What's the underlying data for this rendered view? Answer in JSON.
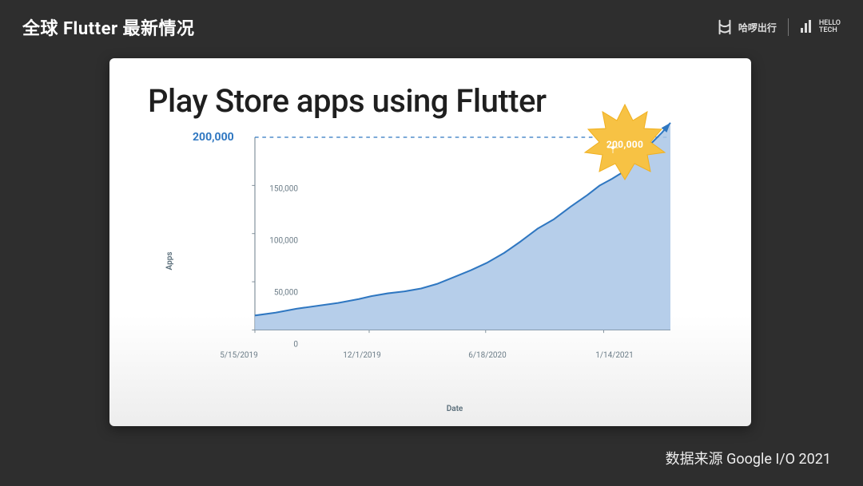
{
  "header": {
    "title": "全球 Flutter 最新情况",
    "logo1_text": "哈啰出行",
    "logo2_line1": "HELLO",
    "logo2_line2": "TECH"
  },
  "footer": {
    "source": "数据来源 Google I/O 2021"
  },
  "chart_data": {
    "type": "area",
    "title": "Play Store apps using Flutter",
    "xlabel": "Date",
    "ylabel": "Apps",
    "ylim": [
      0,
      200000
    ],
    "yticks": [
      0,
      50000,
      100000,
      150000
    ],
    "ytick_labels": [
      "0",
      "50,000",
      "100,000",
      "150,000"
    ],
    "xtick_labels": [
      "5/15/2019",
      "12/1/2019",
      "6/18/2020",
      "1/14/2021"
    ],
    "xtick_positions": [
      0.0,
      0.275,
      0.555,
      0.84
    ],
    "threshold": {
      "value": 200000,
      "label": "200,000"
    },
    "badge": {
      "text": "200,000"
    },
    "series": [
      {
        "name": "Apps",
        "x": [
          0.0,
          0.05,
          0.1,
          0.15,
          0.2,
          0.25,
          0.28,
          0.32,
          0.36,
          0.4,
          0.44,
          0.48,
          0.52,
          0.56,
          0.6,
          0.64,
          0.68,
          0.72,
          0.76,
          0.8,
          0.83,
          0.86,
          0.89,
          0.92,
          0.95,
          0.98,
          1.0
        ],
        "y": [
          15000,
          18000,
          22000,
          25000,
          28000,
          32000,
          35000,
          38000,
          40000,
          43000,
          48000,
          55000,
          62000,
          70000,
          80000,
          92000,
          105000,
          115000,
          128000,
          140000,
          150000,
          157000,
          165000,
          178000,
          192000,
          205000,
          215000
        ]
      }
    ],
    "colors": {
      "line": "#2f77c1",
      "area": "#a9c6e6",
      "threshold": "#2f77c1",
      "badge": "#f7c244"
    }
  }
}
